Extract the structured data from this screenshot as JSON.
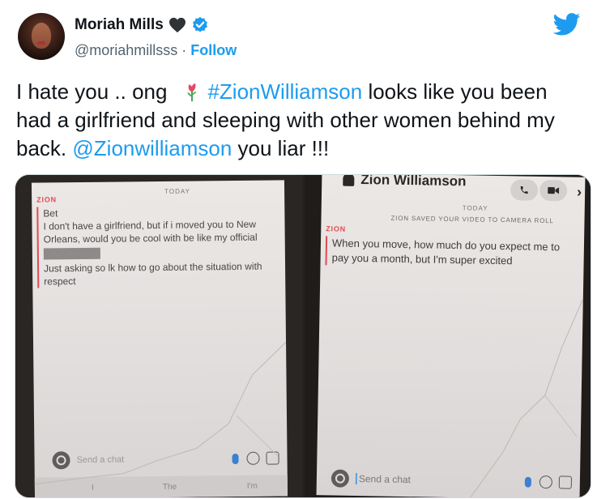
{
  "author": {
    "name": "Moriah Mills",
    "handle": "@moriahmillsss",
    "separator": "·",
    "follow_label": "Follow"
  },
  "tweet": {
    "text_start": "I hate you .. ong",
    "hashtag": "#ZionWilliamson",
    "text_mid": "looks like you been had a girlfriend and sleeping with other women behind my back.",
    "mention": "@Zionwilliamson",
    "text_end": "you liar !!!"
  },
  "icons": {
    "heart": "black-heart-icon",
    "verified": "verified-badge-icon",
    "logo": "twitter-bird-icon",
    "emoji": "rose-icon"
  },
  "colors": {
    "link": "#1d9bf0",
    "snap_red": "#e04b52"
  },
  "screenshot_left": {
    "today": "TODAY",
    "sender": "ZION",
    "messages": [
      "Bet",
      "I don't have a girlfriend, but if i moved you to New Orleans, would you be cool with be like my official",
      "Just asking so lk how to go about the situation with respect"
    ],
    "chat_placeholder": "Send a chat",
    "keyboard_suggestions": [
      "I",
      "The",
      "I'm"
    ]
  },
  "screenshot_right": {
    "contact_name": "Zion Williamson",
    "today": "TODAY",
    "saved_notice": "ZION SAVED YOUR VIDEO TO CAMERA ROLL",
    "sender": "ZION",
    "message": "When you move, how much do you expect me to pay you a month, but I'm super excited",
    "chat_placeholder": "Send a chat"
  }
}
